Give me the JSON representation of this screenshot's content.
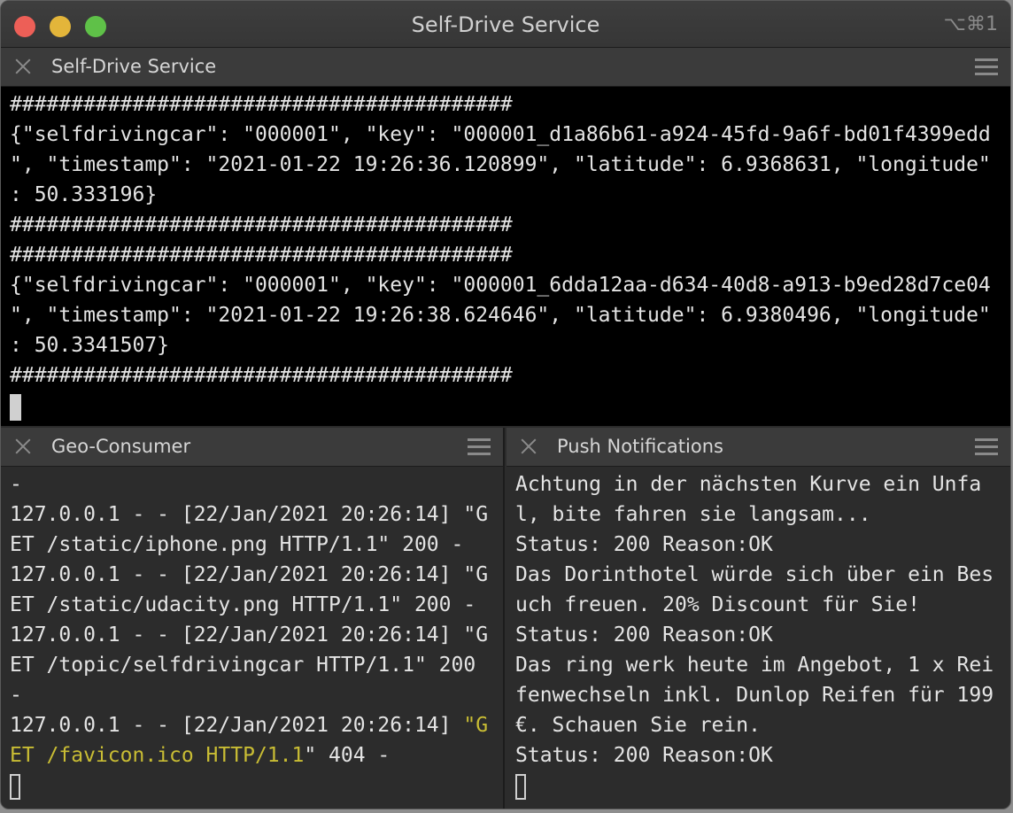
{
  "window": {
    "title": "Self-Drive Service",
    "shortcut": "⌥⌘1"
  },
  "top_pane": {
    "title": "Self-Drive Service",
    "lines": [
      "#########################################",
      "{\"selfdrivingcar\": \"000001\", \"key\": \"000001_d1a86b61-a924-45fd-9a6f-bd01f4399edd",
      "\", \"timestamp\": \"2021-01-22 19:26:36.120899\", \"latitude\": 6.9368631, \"longitude\"",
      ": 50.333196}",
      "#########################################",
      "#########################################",
      "{\"selfdrivingcar\": \"000001\", \"key\": \"000001_6dda12aa-d634-40d8-a913-b9ed28d7ce04",
      "\", \"timestamp\": \"2021-01-22 19:26:38.624646\", \"latitude\": 6.9380496, \"longitude\"",
      ": 50.3341507}",
      "#########################################"
    ]
  },
  "left_pane": {
    "title": "Geo-Consumer",
    "lines": [
      "-",
      "127.0.0.1 - - [22/Jan/2021 20:26:14] \"G",
      "ET /static/iphone.png HTTP/1.1\" 200 -",
      "127.0.0.1 - - [22/Jan/2021 20:26:14] \"G",
      "ET /static/udacity.png HTTP/1.1\" 200 -",
      "127.0.0.1 - - [22/Jan/2021 20:26:14] \"G",
      "ET /topic/selfdrivingcar HTTP/1.1\" 200",
      "-"
    ],
    "last_line_a": "127.0.0.1 - - [22/Jan/2021 20:26:14] ",
    "last_line_b": "\"G",
    "last_line2_a": "ET /favicon.ico HTTP/1.1",
    "last_line2_b": "\" 404 -"
  },
  "right_pane": {
    "title": "Push Notifications",
    "lines": [
      "Achtung in der nächsten Kurve ein Unfa",
      "l, bite fahren sie langsam...",
      "Status: 200 Reason:OK",
      "Das Dorinthotel würde sich über ein Bes",
      "uch freuen. 20% Discount für Sie!",
      "Status: 200 Reason:OK",
      "Das ring werk heute im Angebot, 1 x Rei",
      "fenwechseln inkl. Dunlop Reifen für 199",
      "€. Schauen Sie rein.",
      "Status: 200 Reason:OK"
    ]
  },
  "colors": {
    "background": "#000000",
    "pane_background": "#2c2c2c",
    "text": "#e4e4e4",
    "highlight": "#c9bd34"
  }
}
